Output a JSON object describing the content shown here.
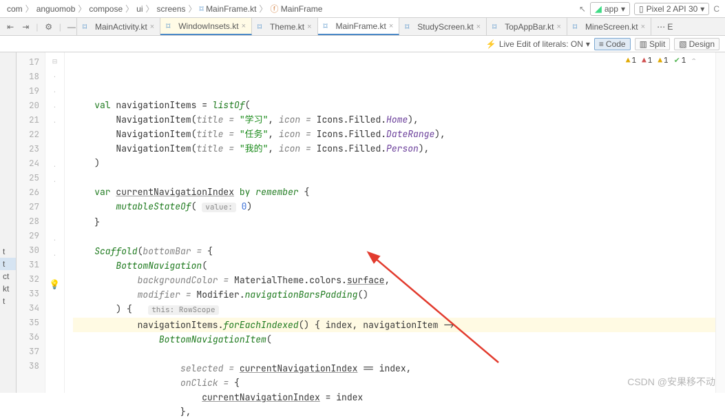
{
  "breadcrumb": [
    "com",
    "anguomob",
    "compose",
    "ui",
    "screens",
    "MainFrame.kt",
    "MainFrame"
  ],
  "run_config": "app",
  "device": "Pixel 2 API 30",
  "tabs": [
    {
      "label": "MainActivity.kt",
      "active": false
    },
    {
      "label": "WindowInsets.kt",
      "active": true,
      "highlight": true
    },
    {
      "label": "Theme.kt",
      "active": false
    },
    {
      "label": "MainFrame.kt",
      "active": true
    },
    {
      "label": "StudyScreen.kt",
      "active": false
    },
    {
      "label": "TopAppBar.kt",
      "active": false
    },
    {
      "label": "MineScreen.kt",
      "active": false
    }
  ],
  "live_edit": "Live Edit of literals: ON",
  "view_modes": {
    "code": "Code",
    "split": "Split",
    "design": "Design"
  },
  "inspections": {
    "warn1": "1",
    "err": "1",
    "warn2": "1",
    "ok": "1"
  },
  "line_start": 17,
  "line_end": 38,
  "tree_items": [
    "t",
    "ct",
    "kt",
    "t"
  ],
  "code_lines": [
    {
      "n": 17,
      "html": "    <span class='kw'>val</span> navigationItems = <span class='fn-it'>listOf</span>("
    },
    {
      "n": 18,
      "html": "        NavigationItem(<span class='param-it'>title = </span><span class='str'>\"学习\"</span>, <span class='param-it'>icon = </span>Icons.Filled.<span class='prop'>Home</span>),"
    },
    {
      "n": 19,
      "html": "        NavigationItem(<span class='param-it'>title = </span><span class='str'>\"任务\"</span>, <span class='param-it'>icon = </span>Icons.Filled.<span class='prop'>DateRange</span>),"
    },
    {
      "n": 20,
      "html": "        NavigationItem(<span class='param-it'>title = </span><span class='str'>\"我的\"</span>, <span class='param-it'>icon = </span>Icons.Filled.<span class='prop'>Person</span>),"
    },
    {
      "n": 21,
      "html": "    )"
    },
    {
      "n": 22,
      "html": ""
    },
    {
      "n": 23,
      "html": "    <span class='kw'>var</span> <span class='underline'>currentNavigationIndex</span> <span class='kw'>by</span> <span class='fn-it'>remember</span> {"
    },
    {
      "n": 24,
      "html": "        <span class='fn-it'>mutableStateOf</span>( <span class='hint'>value:</span> <span class='num'>0</span>)"
    },
    {
      "n": 25,
      "html": "    }"
    },
    {
      "n": 26,
      "html": ""
    },
    {
      "n": 27,
      "html": "    <span class='fn-it'>Scaffold</span>(<span class='param-it'>bottomBar = </span>{"
    },
    {
      "n": 28,
      "html": "        <span class='fn-it'>BottomNavigation</span>("
    },
    {
      "n": 29,
      "html": "            <span class='param-it'>backgroundColor = </span>MaterialTheme.colors.<span class='underline'>surface</span>,"
    },
    {
      "n": 30,
      "html": "            <span class='param-it'>modifier = </span>Modifier.<span class='fn-it'>navigationBarsPadding</span>()"
    },
    {
      "n": 31,
      "html": "        ) {   <span class='hint'>this: RowScope</span>"
    },
    {
      "n": 32,
      "html": "            navigationItems.<span class='fn-it'>forEachIndexed</span>() { index, navigationItem -&gt;",
      "hl": true
    },
    {
      "n": 33,
      "html": "                <span class='fn-it'>BottomNavigationItem</span>("
    },
    {
      "n": 34,
      "html": ""
    },
    {
      "n": 35,
      "html": "                    <span class='param-it'>selected = </span><span class='underline'>currentNavigationIndex</span> == index,"
    },
    {
      "n": 36,
      "html": "                    <span class='param-it'>onClick = </span>{"
    },
    {
      "n": 37,
      "html": "                        <span class='underline'>currentNavigationIndex</span> = index"
    },
    {
      "n": 38,
      "html": "                    },"
    }
  ],
  "watermark": "CSDN @安果移不动"
}
